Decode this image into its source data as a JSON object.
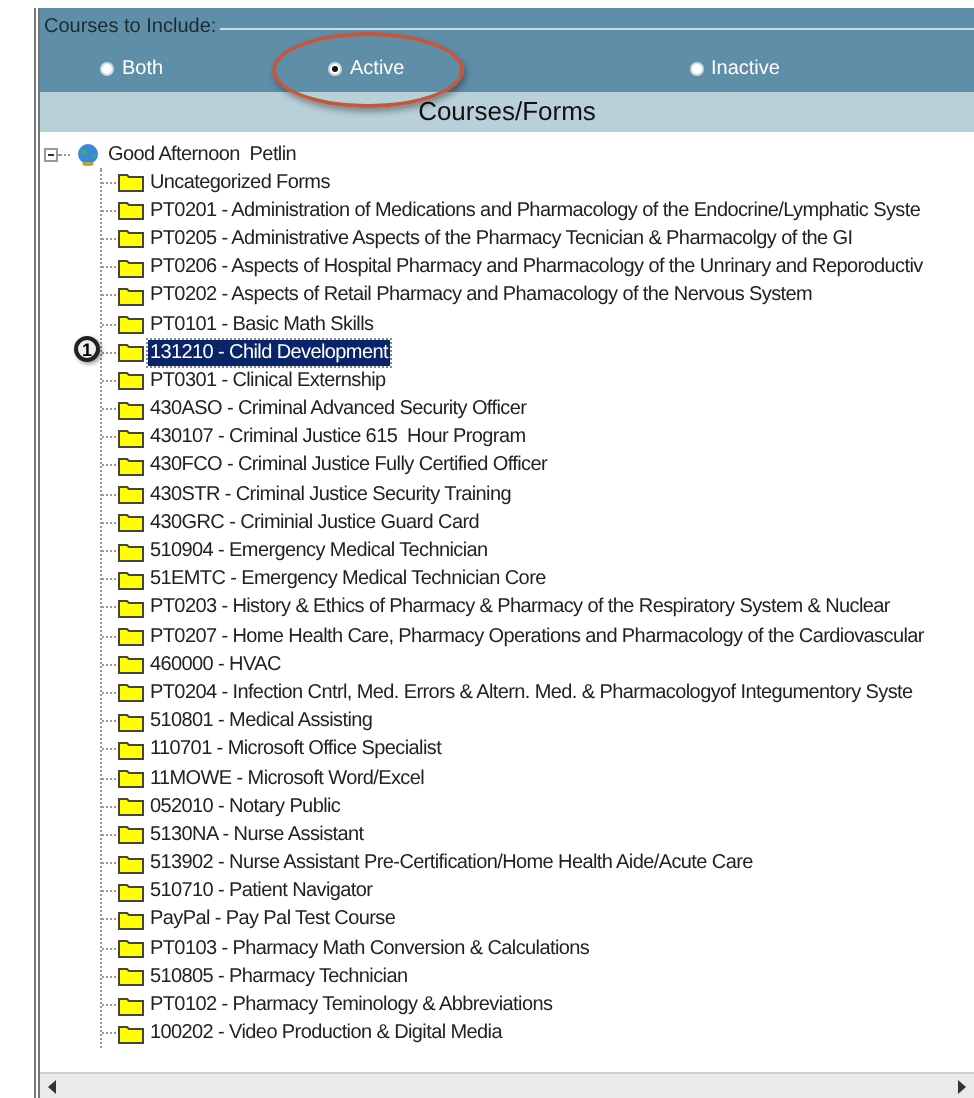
{
  "filter": {
    "legend": "Courses to Include:",
    "options": [
      {
        "label": "Both",
        "selected": false,
        "circled": false
      },
      {
        "label": "Active",
        "selected": true,
        "circled": true
      },
      {
        "label": "Inactive",
        "selected": false,
        "circled": false
      }
    ]
  },
  "header": {
    "title": "Courses/Forms"
  },
  "tree": {
    "label": "Good Afternoon  Petlin",
    "expanded": true,
    "children": [
      {
        "label": "Uncategorized Forms",
        "selected": false
      },
      {
        "label": "PT0201 - Administration of Medications and Pharmacology of the Endocrine/Lymphatic Syste",
        "selected": false
      },
      {
        "label": "PT0205 - Administrative Aspects of the Pharmacy Tecnician & Pharmacolgy of the GI",
        "selected": false
      },
      {
        "label": "PT0206 - Aspects of Hospital Pharmacy and Pharmacology of the Unrinary and Reporoductiv",
        "selected": false
      },
      {
        "label": "PT0202 - Aspects of Retail Pharmacy and Phamacology of the Nervous System",
        "selected": false
      },
      {
        "label": "PT0101 - Basic Math Skills",
        "selected": false
      },
      {
        "label": "131210 - Child Development",
        "selected": true,
        "callout": "1"
      },
      {
        "label": "PT0301 - Clinical Externship",
        "selected": false
      },
      {
        "label": "430ASO - Criminal Advanced Security Officer",
        "selected": false
      },
      {
        "label": "430107 - Criminal Justice 615  Hour Program",
        "selected": false
      },
      {
        "label": "430FCO - Criminal Justice Fully Certified Officer",
        "selected": false
      },
      {
        "label": "430STR - Criminal Justice Security Training",
        "selected": false
      },
      {
        "label": "430GRC - Criminial Justice Guard Card",
        "selected": false
      },
      {
        "label": "510904 - Emergency Medical Technician",
        "selected": false
      },
      {
        "label": "51EMTC - Emergency Medical Technician Core",
        "selected": false
      },
      {
        "label": "PT0203 - History & Ethics of Pharmacy & Pharmacy of the Respiratory System & Nuclear",
        "selected": false
      },
      {
        "label": "PT0207 - Home Health Care, Pharmacy Operations and Pharmacology of the Cardiovascular",
        "selected": false
      },
      {
        "label": "460000 - HVAC",
        "selected": false
      },
      {
        "label": "PT0204 - Infection Cntrl, Med. Errors & Altern. Med. & Pharmacologyof Integumentory Syste",
        "selected": false
      },
      {
        "label": "510801 - Medical Assisting",
        "selected": false
      },
      {
        "label": "110701 - Microsoft Office Specialist",
        "selected": false
      },
      {
        "label": "11MOWE - Microsoft Word/Excel",
        "selected": false
      },
      {
        "label": "052010 - Notary Public",
        "selected": false
      },
      {
        "label": "5130NA - Nurse Assistant",
        "selected": false
      },
      {
        "label": "513902 - Nurse Assistant Pre-Certification/Home Health Aide/Acute Care",
        "selected": false
      },
      {
        "label": "510710 - Patient Navigator",
        "selected": false
      },
      {
        "label": "PayPal - Pay Pal Test Course",
        "selected": false
      },
      {
        "label": "PT0103 - Pharmacy Math Conversion & Calculations",
        "selected": false
      },
      {
        "label": "510805 - Pharmacy Technician",
        "selected": false
      },
      {
        "label": "PT0102 - Pharmacy Teminology & Abbreviations",
        "selected": false
      },
      {
        "label": "100202 - Video Production & Digital Media",
        "selected": false
      }
    ]
  }
}
